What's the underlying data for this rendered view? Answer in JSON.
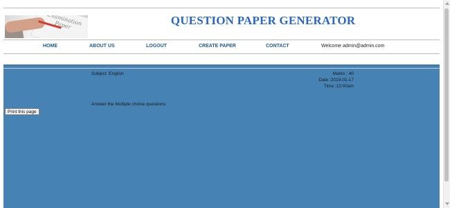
{
  "header": {
    "title": "QUESTION PAPER GENERATOR",
    "logo_text": "Examination Paper"
  },
  "nav": {
    "items": [
      "HOME",
      "ABOUT US",
      "LOGOUT",
      "CREATE PAPER",
      "CONTACT"
    ],
    "welcome": "Welcome admin@admin.com"
  },
  "paper": {
    "subject": "Subject :English",
    "marks": "Marks : 40",
    "date": "Date :2019-01-17",
    "time": "Time :12:00am",
    "instruction": "Answer the Multiple choise questions:",
    "print_label": "Print this page"
  },
  "colors": {
    "title": "#2866c8",
    "nav_link": "#1d5a8e",
    "content_bg": "#4682b4"
  }
}
